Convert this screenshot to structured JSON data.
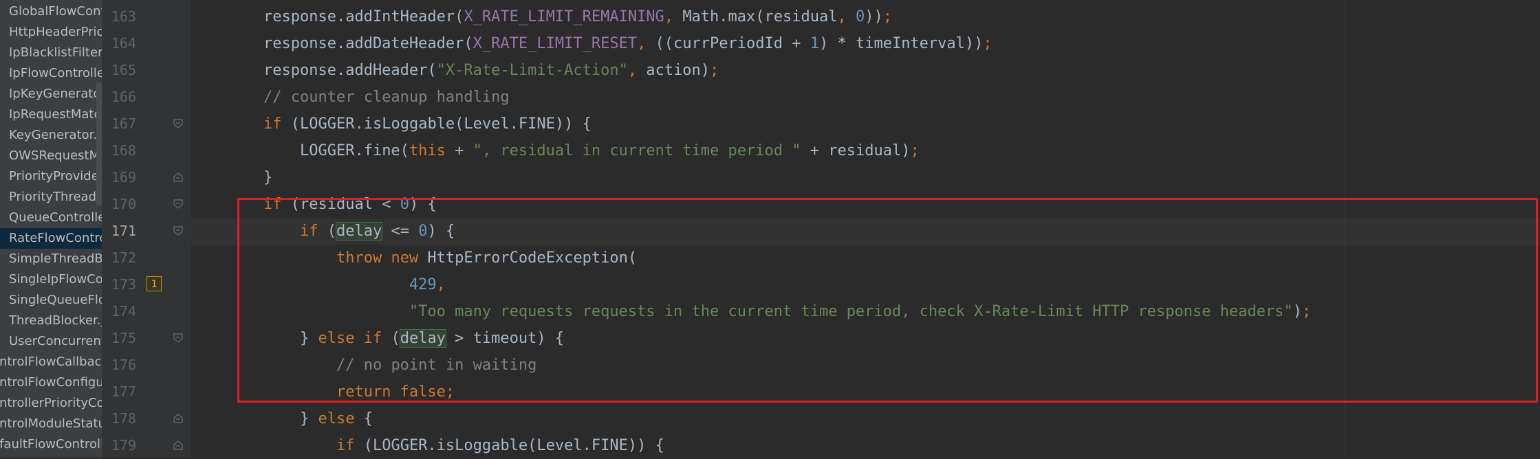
{
  "sidebar": {
    "files": [
      "GlobalFlowController.java",
      "HttpHeaderPriorityProvider.java",
      "IpBlacklistFilter.java",
      "IpFlowController.java",
      "IpKeyGenerator.java",
      "IpRequestMatcher.java",
      "KeyGenerator.java",
      "OWSRequestMatcher.java",
      "PriorityProvider.java",
      "PriorityThreadBlocker.java",
      "QueueController.java",
      "RateFlowController.java",
      "SimpleThreadBlocker.java",
      "SingleIpFlowController.java",
      "SingleQueueFlowController.java",
      "ThreadBlocker.java",
      "UserConcurrentFlowController.java",
      "ontrolFlowCallback",
      "ontrolFlowConfigurator",
      "ontrollerPriorityComparator",
      "ontrolModuleStatus",
      "efaultFlowController"
    ],
    "selected_file": "RateFlowController.java"
  },
  "gutter": {
    "line_numbers": [
      "163",
      "164",
      "165",
      "166",
      "167",
      "168",
      "169",
      "170",
      "171",
      "172",
      "173",
      "174",
      "175",
      "176",
      "177",
      "178",
      "179"
    ],
    "current_line": "171",
    "warning_badge": "1"
  },
  "editor": {
    "lines": [
      [
        [
          "plain",
          "response.addIntHeader("
        ],
        [
          "const",
          "X_RATE_LIMIT_REMAINING"
        ],
        [
          "punct",
          ", "
        ],
        [
          "plain",
          "Math."
        ],
        [
          "plain",
          "max"
        ],
        [
          "plain",
          "(residual"
        ],
        [
          "punct",
          ", "
        ],
        [
          "num",
          "0"
        ],
        [
          "plain",
          "))"
        ],
        [
          "punct",
          ";"
        ]
      ],
      [
        [
          "plain",
          "response.addDateHeader("
        ],
        [
          "const",
          "X_RATE_LIMIT_RESET"
        ],
        [
          "punct",
          ", "
        ],
        [
          "plain",
          "((currPeriodId + "
        ],
        [
          "num",
          "1"
        ],
        [
          "plain",
          ") * timeInterval))"
        ],
        [
          "punct",
          ";"
        ]
      ],
      [
        [
          "plain",
          "response.addHeader("
        ],
        [
          "str",
          "\"X-Rate-Limit-Action\""
        ],
        [
          "punct",
          ", "
        ],
        [
          "plain",
          "action)"
        ],
        [
          "punct",
          ";"
        ]
      ],
      [
        [
          "cmt",
          "// counter cleanup handling"
        ]
      ],
      [
        [
          "kw",
          "if "
        ],
        [
          "plain",
          "("
        ],
        [
          "plain",
          "LOGGER"
        ],
        [
          "plain",
          ".isLoggable(Level."
        ],
        [
          "plain",
          "FINE"
        ],
        [
          "plain",
          ")) {"
        ]
      ],
      [
        [
          "plain",
          "    LOGGER"
        ],
        [
          "plain",
          ".fine("
        ],
        [
          "kw",
          "this"
        ],
        [
          "plain",
          " + "
        ],
        [
          "str",
          "\", residual in current time period \""
        ],
        [
          "plain",
          " + residual)"
        ],
        [
          "punct",
          ";"
        ]
      ],
      [
        [
          "plain",
          "}"
        ]
      ],
      [
        [
          "kw",
          "if "
        ],
        [
          "plain",
          "(residual < "
        ],
        [
          "num",
          "0"
        ],
        [
          "plain",
          ") {"
        ]
      ],
      [
        [
          "plain",
          "    "
        ],
        [
          "kw",
          "if "
        ],
        [
          "plain",
          "("
        ],
        [
          "hl",
          "delay"
        ],
        [
          "plain",
          " <= "
        ],
        [
          "num",
          "0"
        ],
        [
          "plain",
          ") {"
        ]
      ],
      [
        [
          "plain",
          "        "
        ],
        [
          "kw",
          "throw new "
        ],
        [
          "plain",
          "HttpErrorCodeException("
        ]
      ],
      [
        [
          "plain",
          "                "
        ],
        [
          "num",
          "429"
        ],
        [
          "punct",
          ","
        ]
      ],
      [
        [
          "plain",
          "                "
        ],
        [
          "str",
          "\"Too many requests requests in the current time period, check X-Rate-Limit HTTP response headers\""
        ],
        [
          "plain",
          ")"
        ],
        [
          "punct",
          ";"
        ]
      ],
      [
        [
          "plain",
          "    } "
        ],
        [
          "kw",
          "else if "
        ],
        [
          "plain",
          "("
        ],
        [
          "hl",
          "delay"
        ],
        [
          "plain",
          " > timeout) {"
        ]
      ],
      [
        [
          "plain",
          "        "
        ],
        [
          "cmt",
          "// no point in waiting"
        ]
      ],
      [
        [
          "plain",
          "        "
        ],
        [
          "kw",
          "return false"
        ],
        [
          "punct",
          ";"
        ]
      ],
      [
        [
          "plain",
          "    } "
        ],
        [
          "kw",
          "else "
        ],
        [
          "plain",
          "{"
        ]
      ],
      [
        [
          "plain",
          "        "
        ],
        [
          "kw",
          "if "
        ],
        [
          "plain",
          "(LOGGER.isLoggable(Level."
        ],
        [
          "plain",
          "FINE"
        ],
        [
          "plain",
          ")) {"
        ]
      ]
    ]
  },
  "colors": {
    "keyword": "#cc7832",
    "string": "#6a8759",
    "number": "#6897bb",
    "comment": "#808080",
    "constant": "#9876aa",
    "annotation_box": "#e02020"
  }
}
